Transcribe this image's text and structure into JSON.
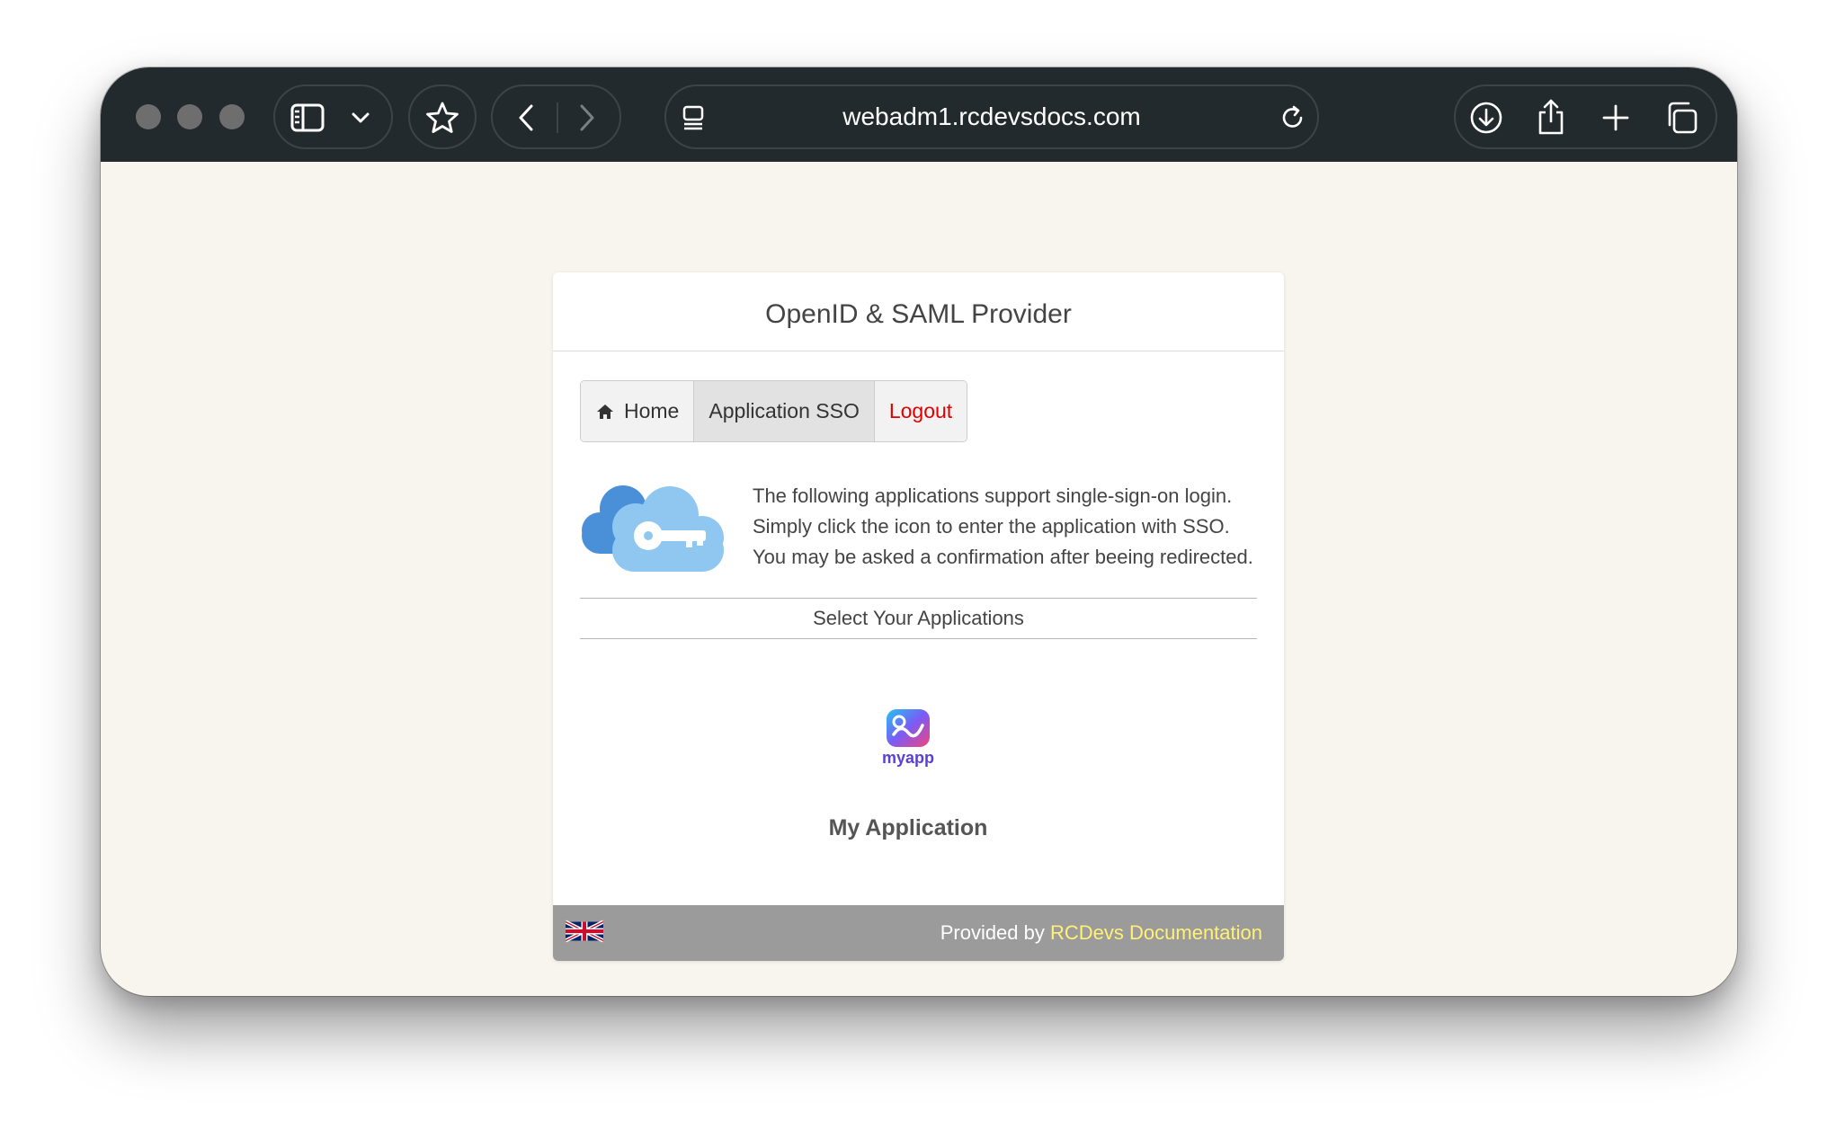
{
  "browser": {
    "url": "webadm1.rcdevsdocs.com",
    "icons": [
      "sidebar-icon",
      "chevron-down-icon",
      "star-icon",
      "back-icon",
      "forward-icon",
      "reader-icon",
      "reload-icon",
      "download-icon",
      "share-icon",
      "plus-icon",
      "tabs-icon"
    ]
  },
  "panel": {
    "title": "OpenID & SAML Provider",
    "nav": {
      "home": "Home",
      "app_sso": "Application SSO",
      "logout": "Logout"
    },
    "intro": [
      "The following applications support single-sign-on login.",
      "Simply click the icon to enter the application with SSO.",
      "You may be asked a confirmation after beeing redirected."
    ],
    "section_title": "Select Your Applications",
    "app": {
      "logo_text": "myapp",
      "name": "My Application"
    },
    "footer": {
      "provided_by": "Provided by",
      "link_text": "RCDevs Documentation"
    }
  },
  "colors": {
    "toolbar": "#232a2d",
    "page_background": "#f8f4ee",
    "logout": "#e00000",
    "footer": "#9b9b9b",
    "footer_link": "#fff176"
  }
}
